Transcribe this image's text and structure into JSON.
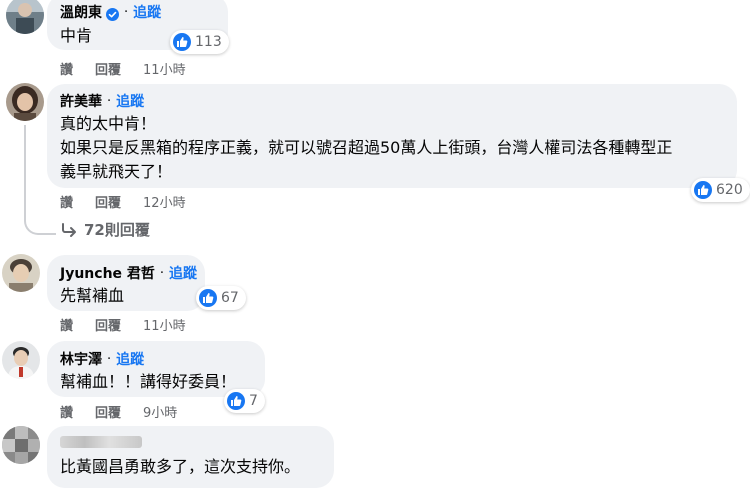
{
  "comments": [
    {
      "author": "溫朗東",
      "follow": "追蹤",
      "lines": [
        "中肯"
      ],
      "like_count": "113",
      "actions": {
        "like": "讚",
        "reply": "回覆",
        "time": "11小時"
      }
    },
    {
      "author": "許美華",
      "follow": "追蹤",
      "lines": [
        "真的太中肯！",
        "如果只是反黑箱的程序正義，就可以號召超過50萬人上街頭，台灣人權司法各種轉型正",
        "義早就飛天了！"
      ],
      "like_count": "620",
      "actions": {
        "like": "讚",
        "reply": "回覆",
        "time": "12小時"
      },
      "replies": "72則回覆"
    },
    {
      "author": "Jyunche 君哲",
      "follow": "追蹤",
      "lines": [
        "先幫補血"
      ],
      "like_count": "67",
      "actions": {
        "like": "讚",
        "reply": "回覆",
        "time": "11小時"
      }
    },
    {
      "author": "林宇澤",
      "follow": "追蹤",
      "lines": [
        "幫補血！！講得好委員！"
      ],
      "like_count": "7",
      "actions": {
        "like": "讚",
        "reply": "回覆",
        "time": "9小時"
      }
    },
    {
      "lines": [
        "比黃國昌勇敢多了，這次支持你。"
      ]
    }
  ],
  "colors": {
    "bubble": "#f0f2f5",
    "link": "#1877f2",
    "secondary_text": "#65676b"
  },
  "icons": [
    "verified-badge-icon",
    "like-thumb-icon",
    "reply-arrow-icon"
  ]
}
